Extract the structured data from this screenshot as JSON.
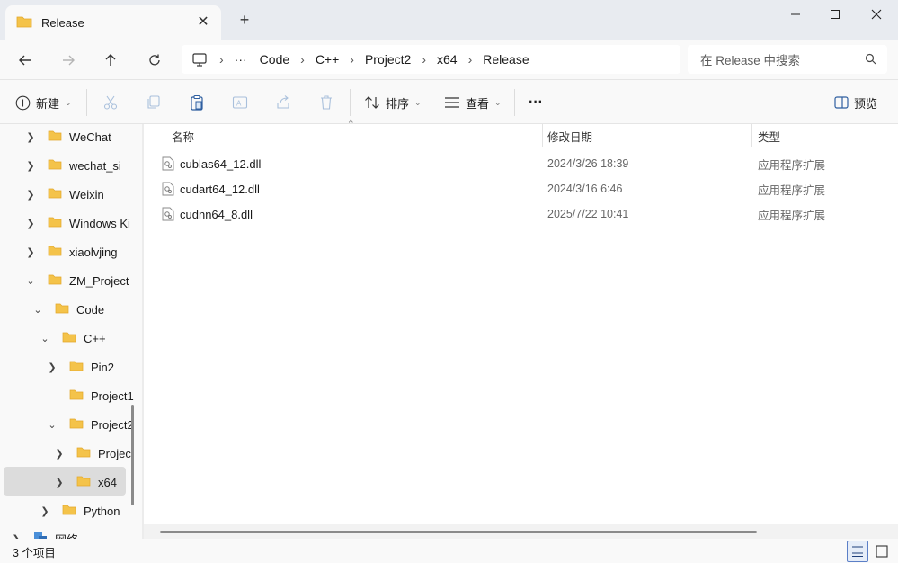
{
  "window": {
    "tab_title": "Release",
    "tab_close": "✕",
    "new_tab": "+",
    "minimize": "—",
    "maximize": "☐",
    "close": "✕"
  },
  "address": {
    "crumbs": [
      "Code",
      "C++",
      "Project2",
      "x64",
      "Release"
    ],
    "overflow": "···",
    "separator": "›",
    "search_placeholder": "在 Release 中搜索"
  },
  "toolbar": {
    "new_label": "新建",
    "sort_label": "排序",
    "view_label": "查看",
    "more_label": "···",
    "preview_label": "预览"
  },
  "sidebar": {
    "items": [
      {
        "label": "WeChat",
        "expanded": false
      },
      {
        "label": "wechat_si",
        "expanded": false
      },
      {
        "label": "Weixin",
        "expanded": false
      },
      {
        "label": "Windows Ki",
        "expanded": false
      },
      {
        "label": "xiaolvjing",
        "expanded": false
      },
      {
        "label": "ZM_Project",
        "expanded": true
      },
      {
        "label": "Code",
        "expanded": true
      },
      {
        "label": "C++",
        "expanded": true
      },
      {
        "label": "Pin2",
        "expanded": false
      },
      {
        "label": "Project1",
        "expanded": null
      },
      {
        "label": "Project2",
        "expanded": true
      },
      {
        "label": "Projec",
        "expanded": false
      },
      {
        "label": "x64",
        "expanded": false,
        "selected": true
      },
      {
        "label": "Python",
        "expanded": false
      },
      {
        "label": "网络",
        "expanded": false
      }
    ]
  },
  "columns": {
    "name": "名称",
    "date": "修改日期",
    "type": "类型"
  },
  "files": [
    {
      "name": "cublas64_12.dll",
      "date": "2024/3/26 18:39",
      "type": "应用程序扩展"
    },
    {
      "name": "cudart64_12.dll",
      "date": "2024/3/16 6:46",
      "type": "应用程序扩展"
    },
    {
      "name": "cudnn64_8.dll",
      "date": "2025/7/22 10:41",
      "type": "应用程序扩展"
    }
  ],
  "status": {
    "item_count": "3 个项目"
  },
  "colors": {
    "folder": "#f4c34a",
    "folder_dark": "#e2a82a",
    "accent": "#5b7fc7"
  }
}
